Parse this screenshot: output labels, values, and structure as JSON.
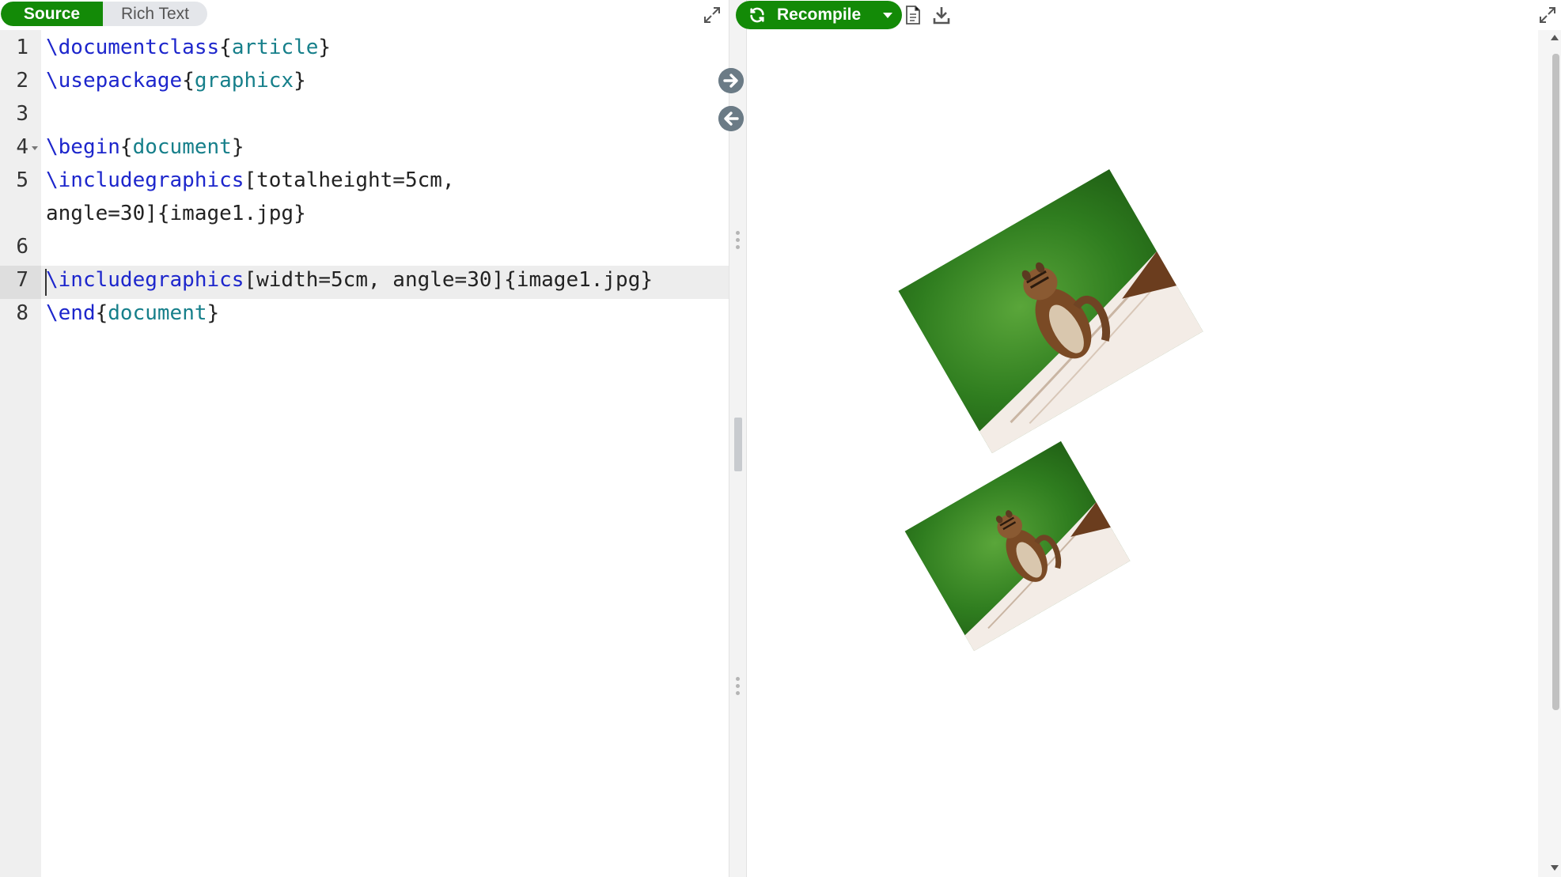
{
  "editor": {
    "modes": {
      "source": "Source",
      "rich_text": "Rich Text"
    },
    "lines": [
      {
        "num": "1",
        "parts": [
          [
            "kw",
            "\\documentclass"
          ],
          [
            "txt",
            "{"
          ],
          [
            "arg",
            "article"
          ],
          [
            "txt",
            "}"
          ]
        ]
      },
      {
        "num": "2",
        "parts": [
          [
            "kw",
            "\\usepackage"
          ],
          [
            "txt",
            "{"
          ],
          [
            "arg",
            "graphicx"
          ],
          [
            "txt",
            "}"
          ]
        ]
      },
      {
        "num": "3",
        "parts": []
      },
      {
        "num": "4",
        "fold": true,
        "parts": [
          [
            "kw",
            "\\begin"
          ],
          [
            "txt",
            "{"
          ],
          [
            "arg",
            "document"
          ],
          [
            "txt",
            "}"
          ]
        ]
      },
      {
        "num": "5",
        "parts": [
          [
            "kw",
            "\\includegraphics"
          ],
          [
            "txt",
            "[totalheight=5cm,"
          ]
        ]
      },
      {
        "num": "",
        "parts": [
          [
            "txt",
            "angle=30]{image1.jpg}"
          ]
        ]
      },
      {
        "num": "6",
        "parts": []
      },
      {
        "num": "7",
        "active": true,
        "parts": [
          [
            "kw",
            "\\includegraphics"
          ],
          [
            "txt",
            "[width=5cm, angle=30]{image1.jpg}"
          ]
        ]
      },
      {
        "num": "8",
        "parts": [
          [
            "kw",
            "\\end"
          ],
          [
            "txt",
            "{"
          ],
          [
            "arg",
            "document"
          ],
          [
            "txt",
            "}"
          ]
        ]
      }
    ]
  },
  "preview": {
    "recompile_label": "Recompile"
  },
  "icons": {
    "expand": "expand-icon",
    "sync_right": "arrow-right-circle-icon",
    "sync_left": "arrow-left-circle-icon",
    "recompile": "refresh-icon",
    "logs": "document-icon",
    "download": "download-icon"
  },
  "colors": {
    "accent_green": "#138a07",
    "keyword_blue": "#1d26cc",
    "argument_teal": "#167f8a"
  }
}
